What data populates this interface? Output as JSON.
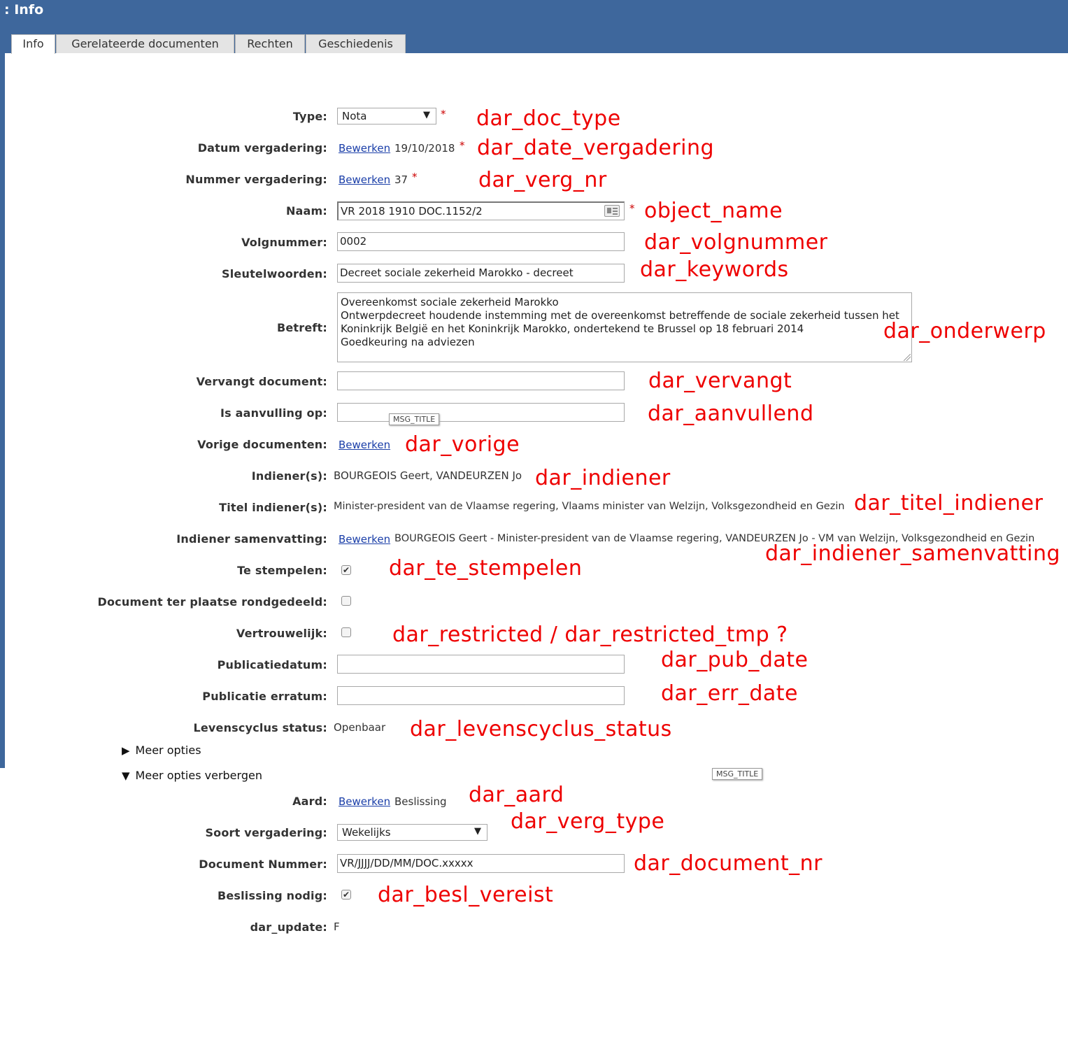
{
  "window": {
    "title": ": Info"
  },
  "tabs": [
    "Info",
    "Gerelateerde documenten",
    "Rechten",
    "Geschiedenis"
  ],
  "link_label": "Bewerken",
  "required_mark": "*",
  "tooltip": "MSG_TITLE",
  "fields": {
    "type": {
      "label": "Type:",
      "value": "Nota",
      "annotation": "dar_doc_type"
    },
    "datum_vergadering": {
      "label": "Datum vergadering:",
      "value": "19/10/2018",
      "annotation": "dar_date_vergadering"
    },
    "nummer_vergadering": {
      "label": "Nummer vergadering:",
      "value": "37",
      "annotation": "dar_verg_nr"
    },
    "naam": {
      "label": "Naam:",
      "value": "VR 2018 1910 DOC.1152/2",
      "annotation": "object_name"
    },
    "volgnummer": {
      "label": "Volgnummer:",
      "value": "0002",
      "annotation": "dar_volgnummer"
    },
    "sleutelwoorden": {
      "label": "Sleutelwoorden:",
      "value": "Decreet sociale zekerheid Marokko - decreet",
      "annotation": "dar_keywords"
    },
    "betreft": {
      "label": "Betreft:",
      "lines": [
        "Overeenkomst sociale zekerheid Marokko",
        "Ontwerpdecreet houdende instemming met de overeenkomst betreffende de sociale zekerheid tussen het",
        "Koninkrijk België en het Koninkrijk Marokko, ondertekend te Brussel op 18 februari 2014",
        "Goedkeuring na adviezen"
      ],
      "annotation": "dar_onderwerp"
    },
    "vervangt": {
      "label": "Vervangt document:",
      "value": "",
      "annotation": "dar_vervangt"
    },
    "aanvulling": {
      "label": "Is aanvulling op:",
      "value": "",
      "annotation": "dar_aanvullend"
    },
    "vorige": {
      "label": "Vorige documenten:",
      "annotation": "dar_vorige"
    },
    "indiener": {
      "label": "Indiener(s):",
      "value": "BOURGEOIS Geert, VANDEURZEN Jo",
      "annotation": "dar_indiener"
    },
    "titel_indiener": {
      "label": "Titel indiener(s):",
      "value": "Minister-president van de Vlaamse regering, Vlaams minister van Welzijn, Volksgezondheid en Gezin",
      "annotation": "dar_titel_indiener"
    },
    "indiener_samenvatting": {
      "label": "Indiener samenvatting:",
      "value": "BOURGEOIS Geert - Minister-president van de Vlaamse regering, VANDEURZEN Jo - VM van Welzijn, Volksgezondheid en Gezin",
      "annotation": "dar_indiener_samenvatting"
    },
    "te_stempelen": {
      "label": "Te stempelen:",
      "checked": true,
      "annotation": "dar_te_stempelen"
    },
    "rondgedeeld": {
      "label": "Document ter plaatse rondgedeeld:",
      "checked": false
    },
    "vertrouwelijk": {
      "label": "Vertrouwelijk:",
      "checked": false,
      "annotation": "dar_restricted / dar_restricted_tmp ?"
    },
    "publicatiedatum": {
      "label": "Publicatiedatum:",
      "value": "",
      "annotation": "dar_pub_date"
    },
    "erratum": {
      "label": "Publicatie erratum:",
      "value": "",
      "annotation": "dar_err_date"
    },
    "levenscyclus": {
      "label": "Levenscyclus status:",
      "value": "Openbaar",
      "annotation": "dar_levenscyclus_status"
    }
  },
  "more_options": {
    "show": "Meer opties",
    "hide": "Meer opties verbergen"
  },
  "extra": {
    "aard": {
      "label": "Aard:",
      "value": "Beslissing",
      "annotation": "dar_aard"
    },
    "soort_vergadering": {
      "label": "Soort vergadering:",
      "value": "Wekelijks",
      "annotation": "dar_verg_type"
    },
    "document_nummer": {
      "label": "Document Nummer:",
      "value": "VR/JJJJ/DD/MM/DOC.xxxxx",
      "annotation": "dar_document_nr"
    },
    "beslissing_nodig": {
      "label": "Beslissing nodig:",
      "checked": true,
      "annotation": "dar_besl_vereist"
    },
    "dar_update": {
      "label": "dar_update:",
      "value": "F"
    }
  }
}
